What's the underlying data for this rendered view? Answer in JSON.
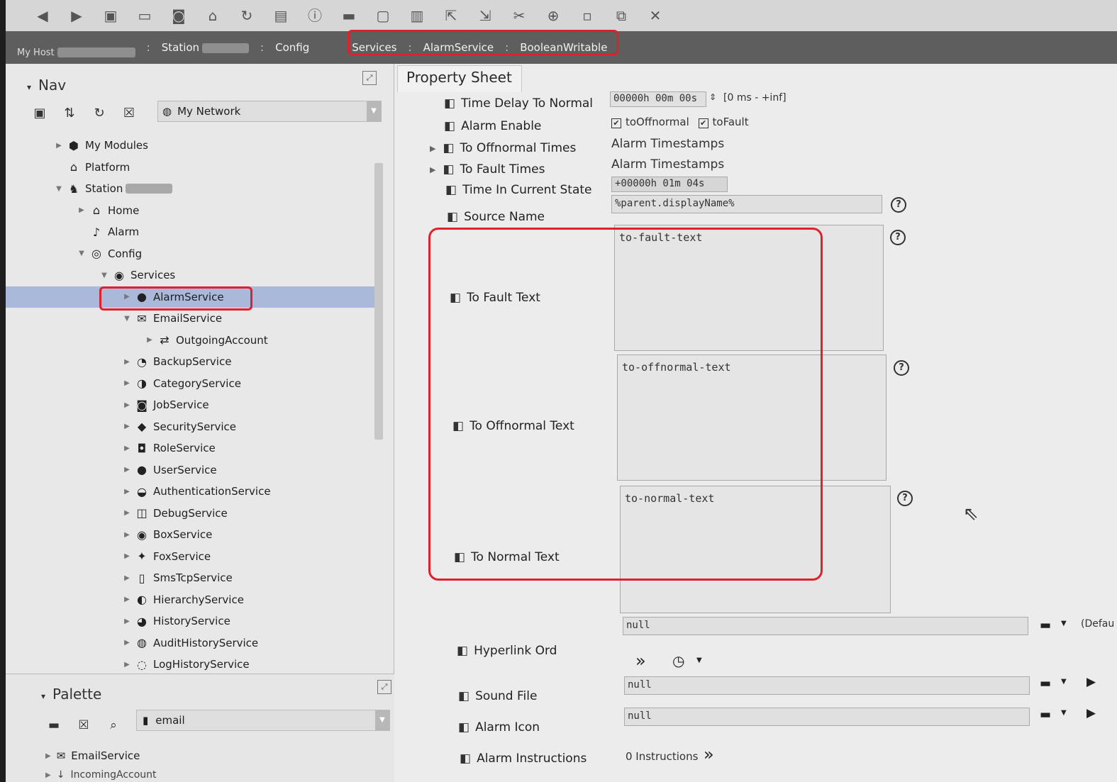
{
  "toolbar": {
    "icons": [
      "back-icon",
      "forward-icon",
      "folder-icon",
      "window-icon",
      "camera-icon",
      "home-icon",
      "refresh-icon",
      "doc-icon",
      "info-icon",
      "folder-dropdown-icon",
      "save-icon",
      "save-all-icon",
      "export-icon",
      "import-icon",
      "cut-icon",
      "copy-icon",
      "paste-icon",
      "duplicate-icon",
      "delete-icon"
    ]
  },
  "breadcrumb": {
    "host_label": "My Host",
    "station_label": "Station",
    "config_label": "Config",
    "services_label": "Services",
    "alarmservice_label": "AlarmService",
    "booleanwritable_label": "BooleanWritable",
    "separator": ":"
  },
  "nav": {
    "title": "Nav",
    "network_select": "My Network",
    "tree": [
      {
        "label": "My Modules",
        "icon": "modules-icon",
        "indent": 0,
        "expander": "▶"
      },
      {
        "label": "Platform",
        "icon": "platform-icon",
        "indent": 0,
        "expander": ""
      },
      {
        "label": "Station",
        "icon": "station-icon",
        "indent": 0,
        "expander": "▼"
      },
      {
        "label": "Home",
        "icon": "home-icon",
        "indent": 1,
        "expander": "▶"
      },
      {
        "label": "Alarm",
        "icon": "bell-icon",
        "indent": 1,
        "expander": ""
      },
      {
        "label": "Config",
        "icon": "database-icon",
        "indent": 1,
        "expander": "▼"
      },
      {
        "label": "Services",
        "icon": "services-icon",
        "indent": 2,
        "expander": "▼"
      },
      {
        "label": "AlarmService",
        "icon": "alarm-service-icon",
        "indent": 3,
        "expander": "▶",
        "selected": true
      },
      {
        "label": "EmailService",
        "icon": "email-icon",
        "indent": 3,
        "expander": "▼"
      },
      {
        "label": "OutgoingAccount",
        "icon": "outgoing-account-icon",
        "indent": 4,
        "expander": "▶"
      },
      {
        "label": "BackupService",
        "icon": "backup-icon",
        "indent": 3,
        "expander": "▶"
      },
      {
        "label": "CategoryService",
        "icon": "category-icon",
        "indent": 3,
        "expander": "▶"
      },
      {
        "label": "JobService",
        "icon": "job-icon",
        "indent": 3,
        "expander": "▶"
      },
      {
        "label": "SecurityService",
        "icon": "shield-icon",
        "indent": 3,
        "expander": "▶"
      },
      {
        "label": "RoleService",
        "icon": "role-icon",
        "indent": 3,
        "expander": "▶"
      },
      {
        "label": "UserService",
        "icon": "user-icon",
        "indent": 3,
        "expander": "▶"
      },
      {
        "label": "AuthenticationService",
        "icon": "auth-icon",
        "indent": 3,
        "expander": "▶"
      },
      {
        "label": "DebugService",
        "icon": "debug-icon",
        "indent": 3,
        "expander": "▶"
      },
      {
        "label": "BoxService",
        "icon": "box-icon",
        "indent": 3,
        "expander": "▶"
      },
      {
        "label": "FoxService",
        "icon": "fox-icon",
        "indent": 3,
        "expander": "▶"
      },
      {
        "label": "SmsTcpService",
        "icon": "phone-icon",
        "indent": 3,
        "expander": "▶"
      },
      {
        "label": "HierarchyService",
        "icon": "hierarchy-icon",
        "indent": 3,
        "expander": "▶"
      },
      {
        "label": "HistoryService",
        "icon": "history-icon",
        "indent": 3,
        "expander": "▶"
      },
      {
        "label": "AuditHistoryService",
        "icon": "audit-icon",
        "indent": 3,
        "expander": "▶"
      },
      {
        "label": "LogHistoryService",
        "icon": "log-icon",
        "indent": 3,
        "expander": "▶"
      }
    ]
  },
  "palette": {
    "title": "Palette",
    "select_value": "email",
    "items": [
      "EmailService",
      "IncomingAccount"
    ]
  },
  "sheet": {
    "tab_label": "Property Sheet",
    "time_delay_to_normal": {
      "label": "Time Delay To Normal",
      "value": "00000h 00m 00s",
      "range": "[0 ms - +inf]"
    },
    "alarm_enable": {
      "label": "Alarm Enable",
      "opt1": "toOffnormal",
      "opt2": "toFault"
    },
    "to_offnormal_times": {
      "label": "To Offnormal Times",
      "value": "Alarm Timestamps"
    },
    "to_fault_times": {
      "label": "To Fault Times",
      "value": "Alarm Timestamps"
    },
    "time_in_current_state": {
      "label": "Time In Current State",
      "value": "+00000h 01m 04s"
    },
    "source_name": {
      "label": "Source Name",
      "value": "%parent.displayName%"
    },
    "to_fault_text": {
      "label": "To Fault Text",
      "value": "to-fault-text"
    },
    "to_offnormal_text": {
      "label": "To Offnormal Text",
      "value": "to-offnormal-text"
    },
    "to_normal_text": {
      "label": "To Normal Text",
      "value": "to-normal-text"
    },
    "hyperlink_ord": {
      "label": "Hyperlink Ord",
      "value": "null",
      "default_label": "(Defau"
    },
    "sound_file": {
      "label": "Sound File",
      "value": "null"
    },
    "alarm_icon": {
      "label": "Alarm Icon",
      "value": "null"
    },
    "alarm_instructions": {
      "label": "Alarm Instructions",
      "value": "0 Instructions"
    }
  },
  "colors": {
    "highlight": "#e0202a",
    "selection": "#aab9d9"
  }
}
